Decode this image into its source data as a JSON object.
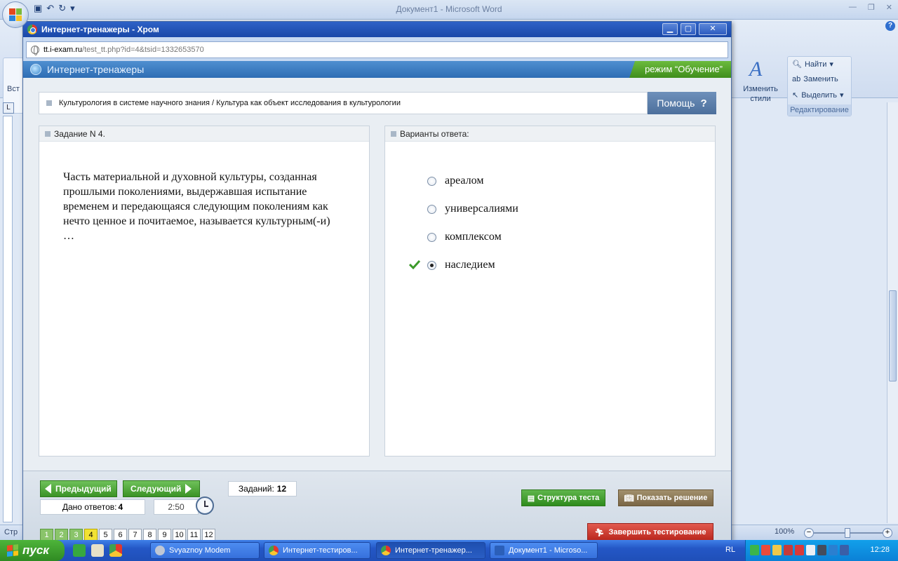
{
  "word": {
    "title": "Документ1 - Microsoft Word",
    "ribbon_left_label": "Вст",
    "styles_label": "Изменить стили",
    "find": "Найти",
    "replace": "Заменить",
    "select": "Выделить",
    "editing_group": "Редактирование",
    "status_left": "Стр",
    "zoom": "100%"
  },
  "browser": {
    "title": "Интернет-тренажеры - Хром",
    "url_host": "tt.i-exam.ru",
    "url_path": "/test_tt.php?id=4&tsid=1332653570"
  },
  "site": {
    "title": "Интернет-тренажеры",
    "mode": "режим “Обучение”",
    "breadcrumb": "Культурология в системе научного знания / Культура как объект исследования в культурологии",
    "help": "Помощь",
    "help_icon": "?"
  },
  "question": {
    "header": "Задание N 4.",
    "text": "Часть материальной и духовной культуры, созданная прошлыми поколениями, выдержавшая испытание временем и передающаяся следующим поколениям как нечто ценное и почитаемое, называется культурным(-и) …"
  },
  "answers": {
    "header": "Варианты ответа:",
    "options": [
      {
        "label": "ареалом",
        "selected": false
      },
      {
        "label": "универсалиями",
        "selected": false
      },
      {
        "label": "комплексом",
        "selected": false
      },
      {
        "label": "наследием",
        "selected": true,
        "correct_mark": "check-icon"
      }
    ]
  },
  "footer": {
    "prev": "Предыдущий",
    "next": "Следующий",
    "tasks_label": "Заданий:",
    "tasks_count": "12",
    "answered_label": "Дано ответов:",
    "answered_count": "4",
    "timer": "2:50",
    "pages": [
      "1",
      "2",
      "3",
      "4",
      "5",
      "6",
      "7",
      "8",
      "9",
      "10",
      "11",
      "12"
    ],
    "answered_pages": [
      "1",
      "2",
      "3"
    ],
    "current_page": "4",
    "structure": "Структура теста",
    "show_solution": "Показать решение",
    "finish": "Завершить тестирование"
  },
  "taskbar": {
    "start": "пуск",
    "tasks": [
      {
        "label": "Svyaznoy Modem"
      },
      {
        "label": "Интернет-тестиров..."
      },
      {
        "label": "Интернет-тренажер..."
      },
      {
        "label": "Документ1 - Microso..."
      }
    ],
    "lang": "RL",
    "time": "12:28"
  },
  "colors": {
    "accent": "#2e6db4",
    "mode_green": "#4f9e26",
    "finish_red": "#c8342a",
    "solution_brown": "#8a7552"
  }
}
